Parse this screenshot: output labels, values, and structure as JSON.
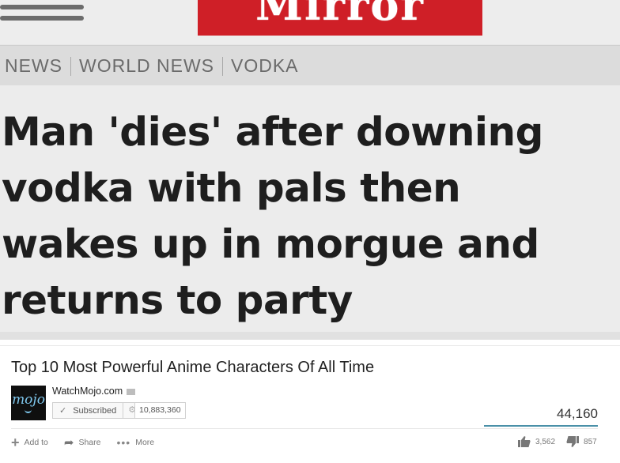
{
  "mirror": {
    "logo": "Mirror",
    "nav": [
      "NEWS",
      "WORLD NEWS",
      "VODKA"
    ],
    "headline": "Man 'dies' after downing\nvodka with pals then\nwakes up in morgue and\nreturns to party"
  },
  "youtube": {
    "title": "Top 10 Most Powerful Anime Characters Of All Time",
    "channel_logo": "mojo",
    "channel_name": "WatchMojo.com",
    "subscribe_label": "Subscribed",
    "subscriber_count": "10,883,360",
    "views": "44,160",
    "actions": {
      "add_to": "Add to",
      "share": "Share",
      "more": "More"
    },
    "likes": "3,562",
    "dislikes": "857",
    "icons": [
      "plus-icon",
      "share-arrow-icon",
      "more-dots-icon",
      "thumbs-up-icon",
      "thumbs-down-icon",
      "check-icon",
      "gear-icon",
      "verified-icon"
    ],
    "colors": {
      "views_bar": "#4a90a8"
    }
  }
}
